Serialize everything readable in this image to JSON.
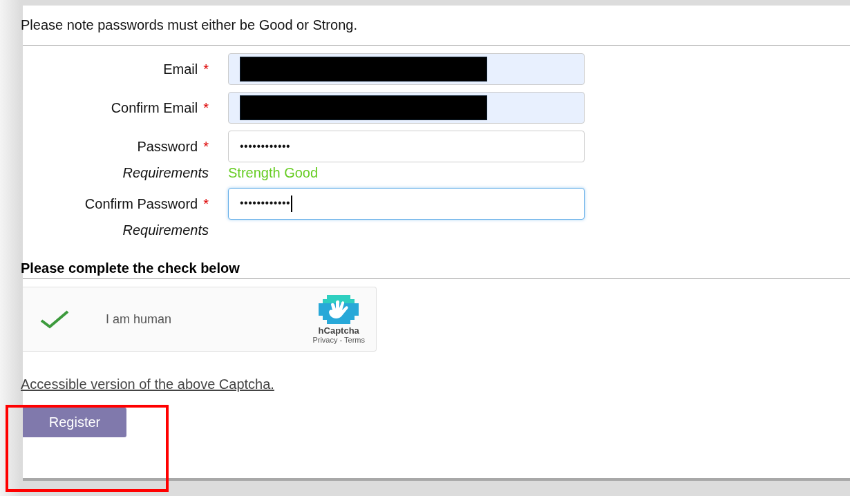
{
  "notice": "Please note passwords must either be Good or Strong.",
  "fields": [
    {
      "kind": "text",
      "label": "Email",
      "required": "*",
      "redacted": true,
      "focused": false,
      "autofilled": true
    },
    {
      "kind": "text",
      "label": "Confirm Email",
      "required": "*",
      "redacted": true,
      "focused": false,
      "autofilled": true
    },
    {
      "kind": "password",
      "label": "Password",
      "required": "*",
      "value": "••••••••••••",
      "focused": false,
      "autofilled": false,
      "requirements": "Requirements",
      "strength": "Strength Good"
    },
    {
      "kind": "password",
      "label": "Confirm Password",
      "required": "*",
      "value": "••••••••••••",
      "focused": true,
      "autofilled": false,
      "requirements": "Requirements"
    }
  ],
  "check_heading": "Please complete the check below",
  "captcha": {
    "checked": true,
    "label": "I am human",
    "brand": "hCaptcha",
    "privacy": "Privacy",
    "separator": "-",
    "terms": "Terms"
  },
  "accessible_link": "Accessible version of the above Captcha.",
  "register_button": {
    "label": "Register",
    "highlighted": true
  }
}
